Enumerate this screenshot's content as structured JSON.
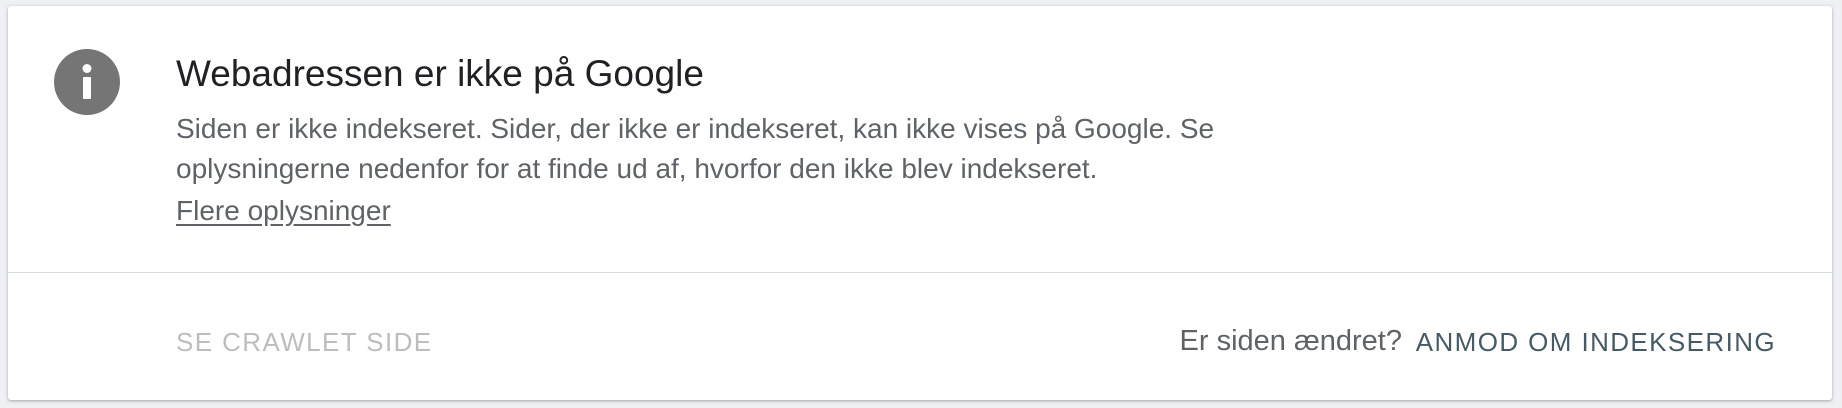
{
  "status_card": {
    "icon": "info-icon",
    "title": "Webadressen er ikke på Google",
    "description": "Siden er ikke indekseret. Sider, der ikke er indekseret, kan ikke vises på Google. Se oplysningerne nedenfor for at finde ud af, hvorfor den ikke blev indekseret.",
    "more_link": "Flere oplysninger"
  },
  "actions": {
    "view_crawled_page": "SE CRAWLET SIDE",
    "changed_question": "Er siden ændret?",
    "request_indexing": "ANMOD OM INDEKSERING"
  },
  "colors": {
    "icon_bg": "#757575",
    "title": "#202124",
    "body_text": "#5f6368",
    "disabled_button": "#bdbdbd",
    "primary_button": "#455a64"
  }
}
